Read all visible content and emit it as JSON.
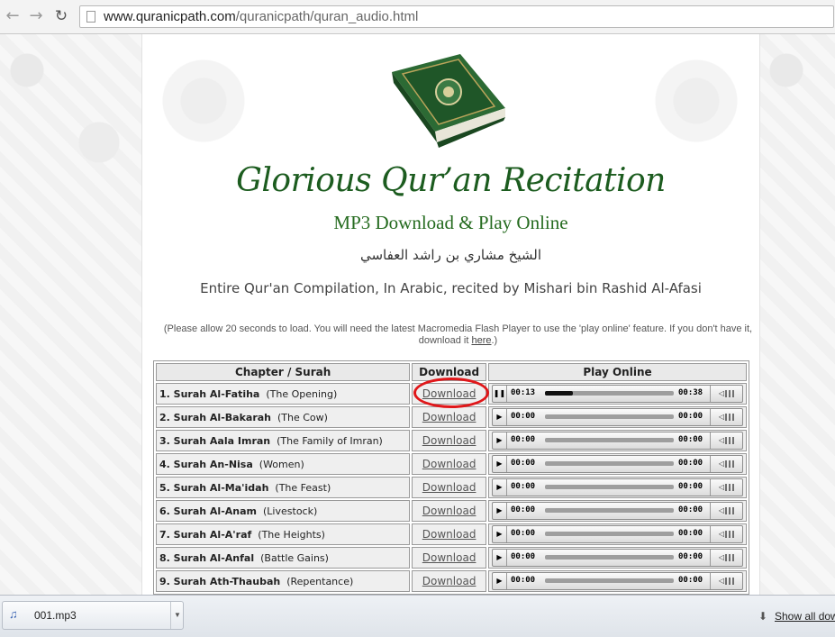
{
  "browser": {
    "url_host": "www.quranicpath.com",
    "url_path": "/quranicpath/quran_audio.html"
  },
  "page": {
    "title": "Glorious Qur’an Recitation",
    "subtitle": "MP3 Download & Play Online",
    "arabic_line": "الشيخ مشاري بن راشد العفاسي",
    "description": "Entire Qur'an Compilation, In Arabic, recited by Mishari bin Rashid Al-Afasi",
    "note_text": "(Please allow 20 seconds to load. You will need the latest Macromedia Flash Player to use the 'play online' feature. If you don't have it, download it ",
    "note_link": "here",
    "note_end": ".)"
  },
  "table": {
    "headers": [
      "Chapter / Surah",
      "Download",
      "Play Online"
    ],
    "rows": [
      {
        "name": "1. Surah Al-Fatiha",
        "meaning": "(The Opening)",
        "download": "Download",
        "time_elapsed": "00:13",
        "duration": "00:38",
        "playing": true,
        "progress": 0.22
      },
      {
        "name": "2. Surah Al-Bakarah",
        "meaning": "(The Cow)",
        "download": "Download",
        "time_elapsed": "00:00",
        "duration": "00:00",
        "playing": false,
        "progress": 0
      },
      {
        "name": "3. Surah Aala Imran",
        "meaning": "(The Family of Imran)",
        "download": "Download",
        "time_elapsed": "00:00",
        "duration": "00:00",
        "playing": false,
        "progress": 0
      },
      {
        "name": "4. Surah An-Nisa",
        "meaning": "(Women)",
        "download": "Download",
        "time_elapsed": "00:00",
        "duration": "00:00",
        "playing": false,
        "progress": 0
      },
      {
        "name": "5. Surah Al-Ma'idah",
        "meaning": "(The Feast)",
        "download": "Download",
        "time_elapsed": "00:00",
        "duration": "00:00",
        "playing": false,
        "progress": 0
      },
      {
        "name": "6. Surah Al-Anam",
        "meaning": "(Livestock)",
        "download": "Download",
        "time_elapsed": "00:00",
        "duration": "00:00",
        "playing": false,
        "progress": 0
      },
      {
        "name": "7. Surah Al-A'raf",
        "meaning": "(The Heights)",
        "download": "Download",
        "time_elapsed": "00:00",
        "duration": "00:00",
        "playing": false,
        "progress": 0
      },
      {
        "name": "8. Surah Al-Anfal",
        "meaning": "(Battle Gains)",
        "download": "Download",
        "time_elapsed": "00:00",
        "duration": "00:00",
        "playing": false,
        "progress": 0
      },
      {
        "name": "9. Surah Ath-Thaubah",
        "meaning": "(Repentance)",
        "download": "Download",
        "time_elapsed": "00:00",
        "duration": "00:00",
        "playing": false,
        "progress": 0
      }
    ]
  },
  "download_shelf": {
    "file_name": "001.mp3",
    "show_all": "Show all dow"
  },
  "colors": {
    "title_green": "#1c5c1f",
    "annotation_red": "#e0171a"
  },
  "icons": [
    "back-arrow-icon",
    "forward-arrow-icon",
    "reload-icon",
    "page-icon",
    "quran-book-image",
    "pause-icon",
    "play-icon",
    "volume-icon",
    "audio-file-icon",
    "dropdown-arrow-icon",
    "download-arrow-icon"
  ]
}
